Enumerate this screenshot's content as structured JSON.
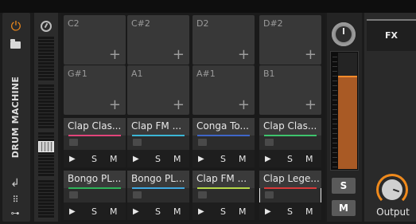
{
  "device": {
    "title": "DRUM MACHINE",
    "accent_color": "#f08a1c"
  },
  "left_strip": {
    "power_icon": "power-icon",
    "folder_icon": "folder-icon",
    "return_icon": "return-arrow-icon",
    "dots_icon": "grid-dots-icon",
    "chain_icon": "chain-icon"
  },
  "pads_empty": [
    {
      "name": "C2"
    },
    {
      "name": "C#2"
    },
    {
      "name": "D2"
    },
    {
      "name": "D#2"
    },
    {
      "name": "G#1"
    },
    {
      "name": "A1"
    },
    {
      "name": "A#1"
    },
    {
      "name": "B1"
    }
  ],
  "pads_filled": [
    {
      "name": "Clap Clas...",
      "color": "#e2447a"
    },
    {
      "name": "Clap FM ...",
      "color": "#3bb6d6"
    },
    {
      "name": "Conga To...",
      "color": "#3f66c8"
    },
    {
      "name": "Clap Clas...",
      "color": "#3ec46d"
    },
    {
      "name": "Bongo PL...",
      "color": "#2fb35a"
    },
    {
      "name": "Bongo PL...",
      "color": "#3fa8e0"
    },
    {
      "name": "Clap FM ...",
      "color": "#b6d84a"
    },
    {
      "name": "Clap Lege...",
      "color": "#d83a3a"
    }
  ],
  "pad_controls": {
    "play": "▶",
    "solo": "S",
    "mute": "M",
    "add": "+"
  },
  "mixer": {
    "solo_label": "S",
    "mute_label": "M",
    "meter_level": 0.8,
    "meter_color": "#a95a25"
  },
  "fx": {
    "tab_label": "FX",
    "output_label": "Output"
  }
}
